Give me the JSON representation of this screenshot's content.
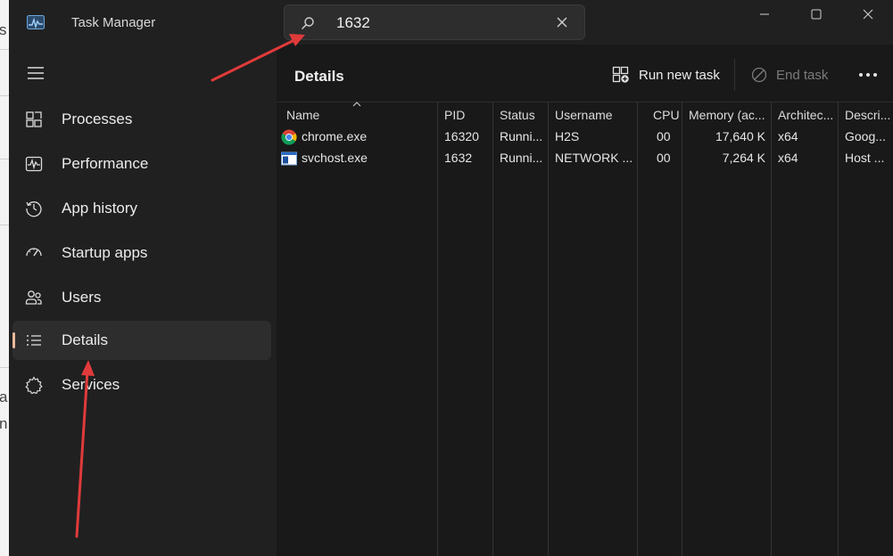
{
  "window": {
    "title": "Task Manager"
  },
  "search": {
    "value": "1632"
  },
  "sidebar": {
    "items": [
      {
        "label": "Processes",
        "icon": "processes-icon"
      },
      {
        "label": "Performance",
        "icon": "performance-icon"
      },
      {
        "label": "App history",
        "icon": "app-history-icon"
      },
      {
        "label": "Startup apps",
        "icon": "startup-apps-icon"
      },
      {
        "label": "Users",
        "icon": "users-icon"
      },
      {
        "label": "Details",
        "icon": "details-icon",
        "active": true
      },
      {
        "label": "Services",
        "icon": "services-icon"
      }
    ]
  },
  "main": {
    "title": "Details",
    "run_new_task": "Run new task",
    "end_task": "End task"
  },
  "table": {
    "columns": [
      "Name",
      "PID",
      "Status",
      "Username",
      "CPU",
      "Memory (ac...",
      "Architec...",
      "Descri..."
    ],
    "rows": [
      {
        "name": "chrome.exe",
        "pid": "16320",
        "status": "Runni...",
        "username": "H2S",
        "cpu": "00",
        "memory": "17,640 K",
        "arch": "x64",
        "desc": "Goog...",
        "icon": "chrome-icon"
      },
      {
        "name": "svchost.exe",
        "pid": "1632",
        "status": "Runni...",
        "username": "NETWORK ...",
        "cpu": "00",
        "memory": "7,264 K",
        "arch": "x64",
        "desc": "Host ...",
        "icon": "svchost-icon"
      }
    ]
  },
  "colors": {
    "accent_indicator": "#e9b99a",
    "annotation_arrow": "#e03a3a"
  }
}
